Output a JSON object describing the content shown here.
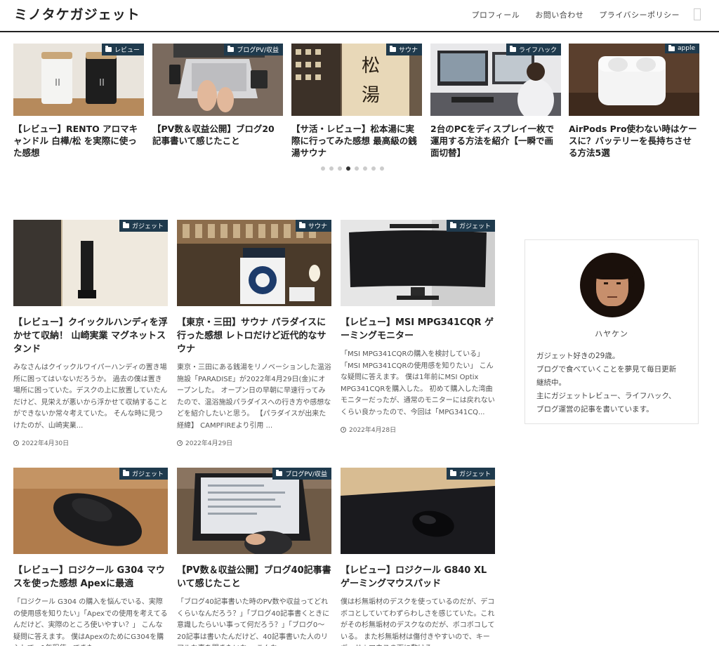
{
  "site": {
    "title": "ミノタケガジェット",
    "nav": [
      "プロフィール",
      "お問い合わせ",
      "プライバシーポリシー"
    ]
  },
  "carousel": {
    "active_index": 3,
    "dot_count": 8,
    "items": [
      {
        "category": "レビュー",
        "title": "【レビュー】RENTO アロマキャンドル 白樺/松 を実際に使った感想"
      },
      {
        "category": "ブログPV/収益",
        "title": "【PV数＆収益公開】ブログ20記事書いて感じたこと"
      },
      {
        "category": "サウナ",
        "title": "【サ活・レビュー】松本湯に実際に行ってみた感想 最高級の銭湯サウナ"
      },
      {
        "category": "ライフハック",
        "title": "2台のPCをディスプレイ一枚で運用する方法を紹介【一瞬で画面切替】"
      },
      {
        "category": "apple",
        "title": "AirPods Pro使わない時はケースに？バッテリーを長持ちさせる方法5選"
      }
    ]
  },
  "posts": [
    {
      "category": "ガジェット",
      "title": "【レビュー】クイックルハンディを浮かせて収納！ 山崎実業 マグネットスタンド",
      "excerpt": "みなさんはクイックルワイパーハンディの置き場所に困ってはいないだろうか。 過去の僕は置き場所に困っていた。デスクの上に放置していたんだけど、見栄えが悪いから浮かせて収納することができないか常々考えていた。 そんな時に見つけたのが、山崎実業...",
      "date": "2022年4月30日"
    },
    {
      "category": "サウナ",
      "title": "【東京・三田】サウナ パラダイスに行った感想 レトロだけど近代的なサウナ",
      "excerpt": "東京・三田にある銭湯をリノベーションした温浴施設「PARADISE」が2022年4月29日(金)にオープンした。 オープン日の早朝に早速行ってみたので、温浴施設パラダイスへの行き方や感想などを紹介したいと思う。 【パラダイスが出来た経緯】 CAMPFIREより引用 ...",
      "date": "2022年4月29日"
    },
    {
      "category": "ガジェット",
      "title": "【レビュー】MSI MPG341CQR ゲーミングモニター",
      "excerpt": "「MSI MPG341CQRの購入を検討している」「MSI MPG341CQRの使用感を知りたい」 こんな疑問に答えます。 僕は1年前にMSI Optix MPG341CQRを購入した。 初めて購入した湾曲モニターだったが、通常のモニターには戻れないくらい良かったので、今回は「MPG341CQ...",
      "date": "2022年4月28日"
    },
    {
      "category": "ガジェット",
      "title": "【レビュー】ロジクール G304 マウスを使った感想 Apexに最適",
      "excerpt": "「ロジクール G304 の購入を悩んでいる、実際の使用感を知りたい」「Apexでの使用を考えてるんだけど、実際のところ使いやすい？」 こんな疑問に答えます。 僕はApexのためにG304を購入して、1年程使ってきた",
      "date": ""
    },
    {
      "category": "ブログPV/収益",
      "title": "【PV数＆収益公開】ブログ40記事書いて感じたこと",
      "excerpt": "「ブログ40記事書いた時のPV数や収益ってどれくらいなんだろう？」「ブログ40記事書くときに意識したらいい事って何だろう？」「ブログ0〜20記事は書いたんだけど、40記事書いた人のリアルな事を聞きたいな」 こんな",
      "date": ""
    },
    {
      "category": "ガジェット",
      "title": "【レビュー】ロジクール G840 XLゲーミングマウスパッド",
      "excerpt": "僕は杉無垢材のデスクを使っているのだが、デコボコとしていてわずらわしさを感じていた。これがその杉無垢材のデスクなのだが、ボコボコしている。 また杉無垢材は傷付きやすいので、キーボード＋マウスの下に敷ける",
      "date": ""
    }
  ],
  "profile": {
    "name": "ハヤケン",
    "bio": [
      "ガジェット好きの29歳。",
      "ブログで食べていくことを夢見て毎日更新",
      "継続中。",
      "主にガジェットレビュー、ライフハック、",
      "ブログ運営の記事を書いています。"
    ]
  }
}
